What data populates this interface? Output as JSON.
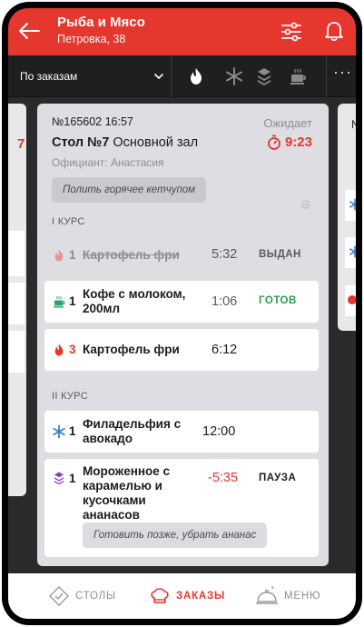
{
  "header": {
    "title": "Рыба и Мясо",
    "subtitle": "Петровка, 38"
  },
  "toolbar": {
    "filter_label": "По заказам",
    "more_label": "···",
    "icons": [
      "fire-icon",
      "snowflake-icon",
      "layers-icon",
      "coffee-icon"
    ]
  },
  "side_cards": {
    "left_partial_text": "7",
    "right_partial_text": "№"
  },
  "order": {
    "number": "№165602 16:57",
    "status": "Ожидает",
    "table_label": "Стол №7",
    "hall": "Основной зал",
    "timer": "9:23",
    "waiter": "Официант: Анастасия",
    "note": "Полить горячее кетчупом",
    "courses": [
      {
        "label": "I КУРС",
        "items": [
          {
            "icon": "fire-icon",
            "qty": "1",
            "name": "Картофель фри",
            "time": "5:32",
            "status": "ВЫДАН"
          },
          {
            "icon": "coffee-icon",
            "qty": "1",
            "name": "Кофе с молоком, 200мл",
            "time": "1:06",
            "status": "ГОТОВ"
          },
          {
            "icon": "fire-icon",
            "qty": "3",
            "name": "Картофель фри",
            "time": "6:12",
            "status": ""
          }
        ]
      },
      {
        "label": "II КУРС",
        "items": [
          {
            "icon": "snowflake-icon",
            "qty": "1",
            "name": "Филадельфия с авокадо",
            "time": "12:00",
            "status": ""
          },
          {
            "icon": "layers-icon",
            "qty": "1",
            "name": "Мороженное с карамелью и кусочками ананасов",
            "time": "-5:35",
            "status": "ПАУЗА",
            "note": "Готовить позже, убрать ананас"
          }
        ]
      }
    ]
  },
  "nav": {
    "tables": "СТОЛЫ",
    "orders": "ЗАКАЗЫ",
    "menu": "МЕНЮ",
    "active": "orders"
  },
  "colors": {
    "brand": "#e5372e",
    "ready": "#2e9a55",
    "cold": "#2f7fd6",
    "dessert": "#8a3fc1",
    "drink": "#2fa36a"
  }
}
